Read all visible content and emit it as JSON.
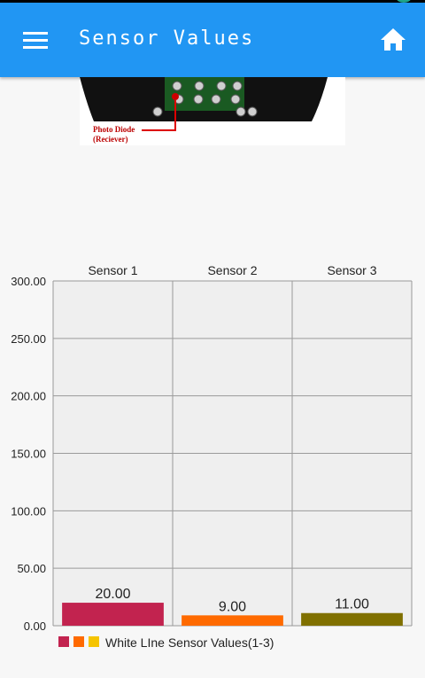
{
  "app": {
    "title": "Sensor Values",
    "icons": {
      "menu": "hamburger-menu-icon",
      "home": "home-icon"
    },
    "colors": {
      "appbar": "#2196f3",
      "background": "#f7f7f7"
    }
  },
  "image": {
    "caption_line1": "Photo Diode",
    "caption_line2": "(Reciever)"
  },
  "chart_data": {
    "type": "bar",
    "categories": [
      "Sensor 1",
      "Sensor 2",
      "Sensor 3"
    ],
    "values": [
      20,
      9,
      11
    ],
    "value_labels": [
      "20.00",
      "9.00",
      "11.00"
    ],
    "colors": [
      "#c2234f",
      "#ff6a00",
      "#807000"
    ],
    "ylim": [
      0,
      300
    ],
    "y_ticks": [
      0,
      50,
      100,
      150,
      200,
      250,
      300
    ],
    "y_tick_labels": [
      "0.00",
      "50.00",
      "100.00",
      "150.00",
      "200.00",
      "250.00",
      "300.00"
    ],
    "grid": true,
    "legend": {
      "position": "bottom-left",
      "label": "White LIne Sensor Values(1-3)",
      "swatch_colors": [
        "#c2234f",
        "#ff6a00",
        "#f5c400"
      ]
    }
  }
}
